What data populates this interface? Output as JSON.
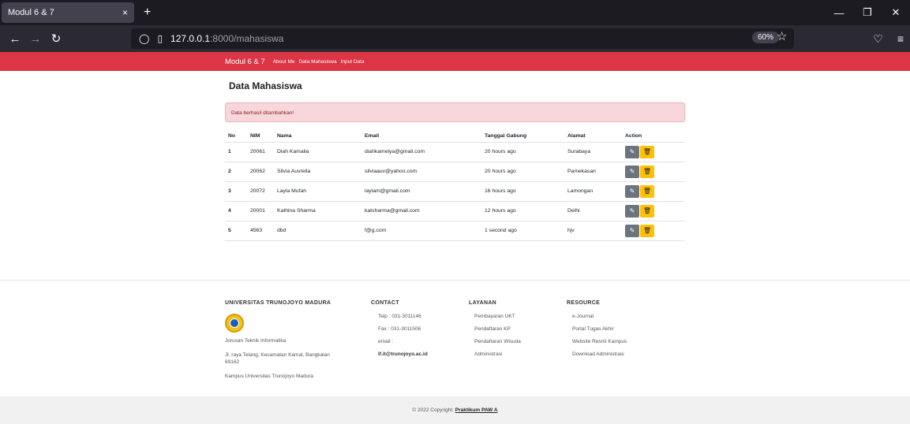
{
  "browser": {
    "tab_title": "Modul 6 & 7",
    "tab_close": "×",
    "new_tab": "+",
    "url_host": "127.0.0.1",
    "url_path": ":8000/mahasiswa",
    "zoom": "60%"
  },
  "nav": {
    "brand": "Modul 6 & 7",
    "links": [
      "About Me",
      "Data Mahasiswa",
      "Input Data"
    ]
  },
  "page": {
    "title": "Data Mahasiswa",
    "alert": "Data berhasil ditambahkan!"
  },
  "table": {
    "headers": [
      "No",
      "NIM",
      "Nama",
      "Email",
      "Tanggal Gabung",
      "Alamat",
      "Action"
    ],
    "rows": [
      [
        "1",
        "20061",
        "Diah Kamalia",
        "diahkamelya@gmail.com",
        "20 hours ago",
        "Surabaya"
      ],
      [
        "2",
        "20062",
        "Silvia Auvrelia",
        "silviaauv@yahoo.com",
        "20 hours ago",
        "Pamekasan"
      ],
      [
        "3",
        "20072",
        "Layla Mufah",
        "laylam@gmail.com",
        "16 hours ago",
        "Lamongan"
      ],
      [
        "4",
        "20001",
        "Kathina Sharma",
        "katsharma@gmail.com",
        "12 hours ago",
        "Delhi"
      ],
      [
        "5",
        "4563",
        "dbd",
        "f@g.com",
        "1 second ago",
        "hjv"
      ]
    ]
  },
  "footer": {
    "univ": {
      "heading": "UNIVERSITAS TRUNOJOYO MADURA",
      "dept": "Jurusan Teknik Informatika",
      "address": "Jl. raya Telang, Kecamatan Kamal, Bangkalan",
      "zip": "69162",
      "campus": "Kampus Universitas Trunojoyo Madura"
    },
    "contact": {
      "heading": "CONTACT",
      "telp": "Telp : 031-3011146",
      "fax": "Fax : 031-3011506",
      "email_label": "email :",
      "email": "if.it@trunojoyo.ac.id"
    },
    "layanan": {
      "heading": "LAYANAN",
      "items": [
        "Pembayaran UKT",
        "Pendaftaran KP",
        "Pendaftaran Wisuda",
        "Administrasi"
      ]
    },
    "resource": {
      "heading": "RESOURCE",
      "items": [
        "e-Journal",
        "Portal Tugas Akhir",
        "Website Resmi Kampus",
        "Download Administrasi"
      ]
    },
    "copyright_prefix": "© 2022 Copyright:",
    "copyright_link": "Praktikum PAW A"
  }
}
